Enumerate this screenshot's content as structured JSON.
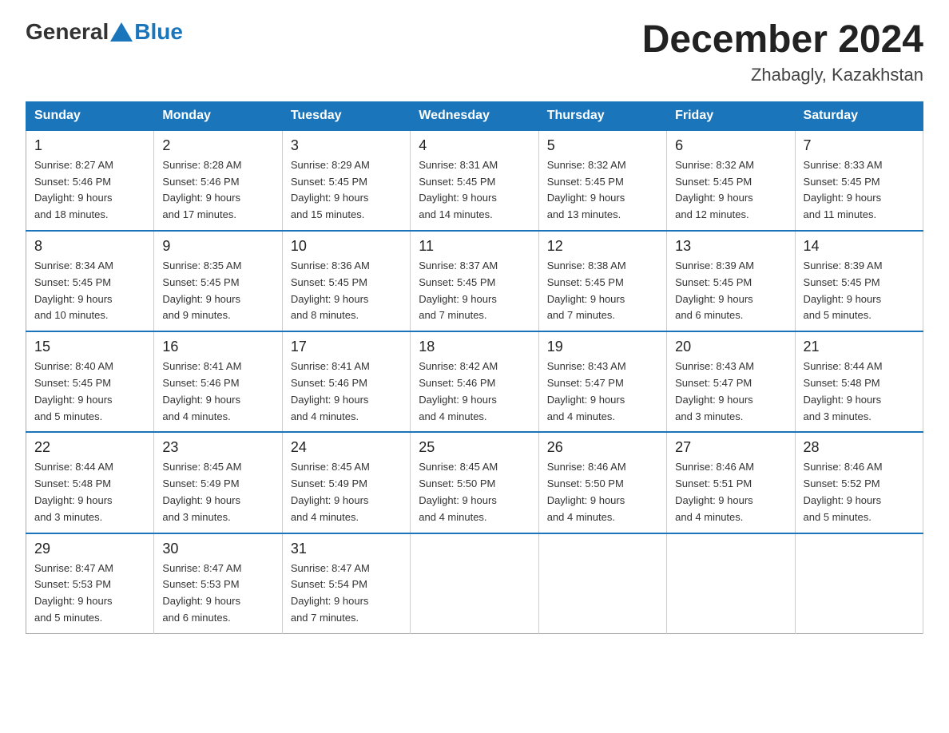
{
  "header": {
    "logo": {
      "part1": "General",
      "part2": "Blue"
    },
    "title": "December 2024",
    "subtitle": "Zhabagly, Kazakhstan"
  },
  "weekdays": [
    "Sunday",
    "Monday",
    "Tuesday",
    "Wednesday",
    "Thursday",
    "Friday",
    "Saturday"
  ],
  "weeks": [
    [
      {
        "day": "1",
        "sunrise": "8:27 AM",
        "sunset": "5:46 PM",
        "daylight": "9 hours and 18 minutes."
      },
      {
        "day": "2",
        "sunrise": "8:28 AM",
        "sunset": "5:46 PM",
        "daylight": "9 hours and 17 minutes."
      },
      {
        "day": "3",
        "sunrise": "8:29 AM",
        "sunset": "5:45 PM",
        "daylight": "9 hours and 15 minutes."
      },
      {
        "day": "4",
        "sunrise": "8:31 AM",
        "sunset": "5:45 PM",
        "daylight": "9 hours and 14 minutes."
      },
      {
        "day": "5",
        "sunrise": "8:32 AM",
        "sunset": "5:45 PM",
        "daylight": "9 hours and 13 minutes."
      },
      {
        "day": "6",
        "sunrise": "8:32 AM",
        "sunset": "5:45 PM",
        "daylight": "9 hours and 12 minutes."
      },
      {
        "day": "7",
        "sunrise": "8:33 AM",
        "sunset": "5:45 PM",
        "daylight": "9 hours and 11 minutes."
      }
    ],
    [
      {
        "day": "8",
        "sunrise": "8:34 AM",
        "sunset": "5:45 PM",
        "daylight": "9 hours and 10 minutes."
      },
      {
        "day": "9",
        "sunrise": "8:35 AM",
        "sunset": "5:45 PM",
        "daylight": "9 hours and 9 minutes."
      },
      {
        "day": "10",
        "sunrise": "8:36 AM",
        "sunset": "5:45 PM",
        "daylight": "9 hours and 8 minutes."
      },
      {
        "day": "11",
        "sunrise": "8:37 AM",
        "sunset": "5:45 PM",
        "daylight": "9 hours and 7 minutes."
      },
      {
        "day": "12",
        "sunrise": "8:38 AM",
        "sunset": "5:45 PM",
        "daylight": "9 hours and 7 minutes."
      },
      {
        "day": "13",
        "sunrise": "8:39 AM",
        "sunset": "5:45 PM",
        "daylight": "9 hours and 6 minutes."
      },
      {
        "day": "14",
        "sunrise": "8:39 AM",
        "sunset": "5:45 PM",
        "daylight": "9 hours and 5 minutes."
      }
    ],
    [
      {
        "day": "15",
        "sunrise": "8:40 AM",
        "sunset": "5:45 PM",
        "daylight": "9 hours and 5 minutes."
      },
      {
        "day": "16",
        "sunrise": "8:41 AM",
        "sunset": "5:46 PM",
        "daylight": "9 hours and 4 minutes."
      },
      {
        "day": "17",
        "sunrise": "8:41 AM",
        "sunset": "5:46 PM",
        "daylight": "9 hours and 4 minutes."
      },
      {
        "day": "18",
        "sunrise": "8:42 AM",
        "sunset": "5:46 PM",
        "daylight": "9 hours and 4 minutes."
      },
      {
        "day": "19",
        "sunrise": "8:43 AM",
        "sunset": "5:47 PM",
        "daylight": "9 hours and 4 minutes."
      },
      {
        "day": "20",
        "sunrise": "8:43 AM",
        "sunset": "5:47 PM",
        "daylight": "9 hours and 3 minutes."
      },
      {
        "day": "21",
        "sunrise": "8:44 AM",
        "sunset": "5:48 PM",
        "daylight": "9 hours and 3 minutes."
      }
    ],
    [
      {
        "day": "22",
        "sunrise": "8:44 AM",
        "sunset": "5:48 PM",
        "daylight": "9 hours and 3 minutes."
      },
      {
        "day": "23",
        "sunrise": "8:45 AM",
        "sunset": "5:49 PM",
        "daylight": "9 hours and 3 minutes."
      },
      {
        "day": "24",
        "sunrise": "8:45 AM",
        "sunset": "5:49 PM",
        "daylight": "9 hours and 4 minutes."
      },
      {
        "day": "25",
        "sunrise": "8:45 AM",
        "sunset": "5:50 PM",
        "daylight": "9 hours and 4 minutes."
      },
      {
        "day": "26",
        "sunrise": "8:46 AM",
        "sunset": "5:50 PM",
        "daylight": "9 hours and 4 minutes."
      },
      {
        "day": "27",
        "sunrise": "8:46 AM",
        "sunset": "5:51 PM",
        "daylight": "9 hours and 4 minutes."
      },
      {
        "day": "28",
        "sunrise": "8:46 AM",
        "sunset": "5:52 PM",
        "daylight": "9 hours and 5 minutes."
      }
    ],
    [
      {
        "day": "29",
        "sunrise": "8:47 AM",
        "sunset": "5:53 PM",
        "daylight": "9 hours and 5 minutes."
      },
      {
        "day": "30",
        "sunrise": "8:47 AM",
        "sunset": "5:53 PM",
        "daylight": "9 hours and 6 minutes."
      },
      {
        "day": "31",
        "sunrise": "8:47 AM",
        "sunset": "5:54 PM",
        "daylight": "9 hours and 7 minutes."
      },
      null,
      null,
      null,
      null
    ]
  ],
  "labels": {
    "sunrise": "Sunrise:",
    "sunset": "Sunset:",
    "daylight": "Daylight:"
  }
}
